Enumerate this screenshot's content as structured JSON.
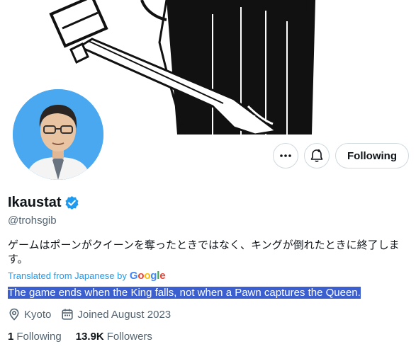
{
  "profile": {
    "display_name": "Ikaustat",
    "handle": "@trohsgib",
    "bio": "ゲームはポーンがクイーンを奪ったときではなく、キングが倒れたときに終了します。",
    "translated_from": "Translated from Japanese by",
    "translator_brand": {
      "g1": "G",
      "o1": "o",
      "o2": "o",
      "g2": "g",
      "l": "l",
      "e": "e"
    },
    "translation": "The game ends when the King falls, not when a Pawn captures the Queen.",
    "location": "Kyoto",
    "joined": "Joined August 2023",
    "following_count": "1",
    "following_label": "Following",
    "followers_count": "13.9K",
    "followers_label": "Followers"
  },
  "actions": {
    "follow_label": "Following",
    "more_icon": "more-icon",
    "notify_icon": "bell-icon"
  },
  "icons": {
    "verified": "verified-badge-icon",
    "location": "location-pin-icon",
    "calendar": "calendar-icon"
  },
  "colors": {
    "verified": "#1d9bf0",
    "avatar_bg": "#4aa8f0",
    "selection": "#3c5fd0",
    "muted": "#536471"
  }
}
